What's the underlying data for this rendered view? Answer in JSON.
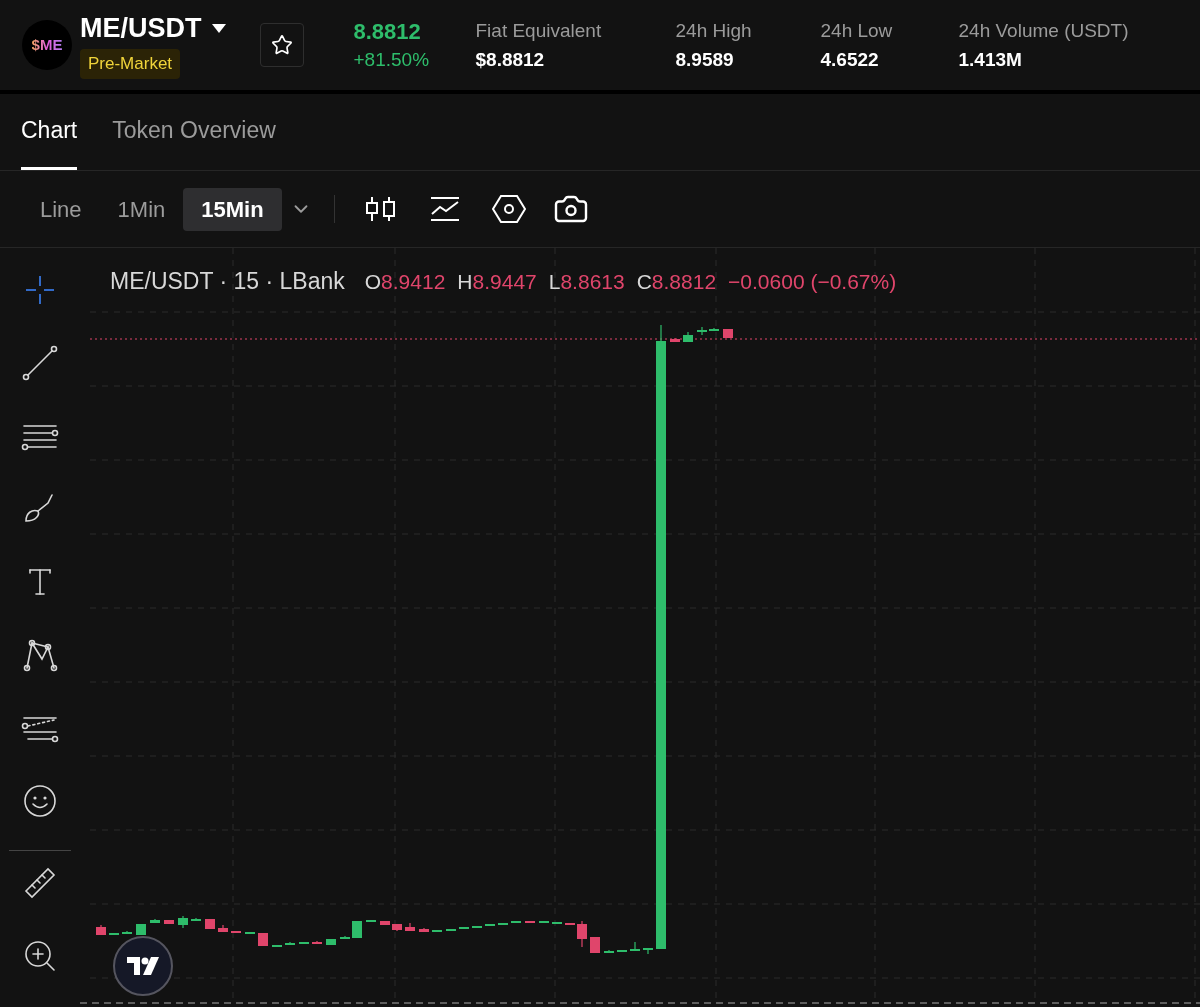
{
  "pair": {
    "logo_text": "$ME",
    "symbol": "ME/USDT",
    "badge": "Pre-Market",
    "favorite": false
  },
  "price": {
    "last": "8.8812",
    "change": "+81.50%"
  },
  "stats": [
    {
      "label": "Fiat Equivalent",
      "value": "$8.8812"
    },
    {
      "label": "24h High",
      "value": "8.9589"
    },
    {
      "label": "24h Low",
      "value": "4.6522"
    },
    {
      "label": "24h Volume (USDT)",
      "value": "1.413M"
    }
  ],
  "tabs": [
    {
      "label": "Chart",
      "selected": true
    },
    {
      "label": "Token Overview",
      "selected": false
    }
  ],
  "intervals": [
    {
      "label": "Line",
      "selected": false
    },
    {
      "label": "1Min",
      "selected": false
    },
    {
      "label": "15Min",
      "selected": true
    }
  ],
  "legend": {
    "title": "ME/USDT · 15 · LBank",
    "ohlc": [
      {
        "label": "O",
        "value": "8.9412"
      },
      {
        "label": "H",
        "value": "8.9447"
      },
      {
        "label": "L",
        "value": "8.8613"
      },
      {
        "label": "C",
        "value": "8.8812"
      }
    ],
    "change": "−0.0600 (−0.67%)"
  }
}
